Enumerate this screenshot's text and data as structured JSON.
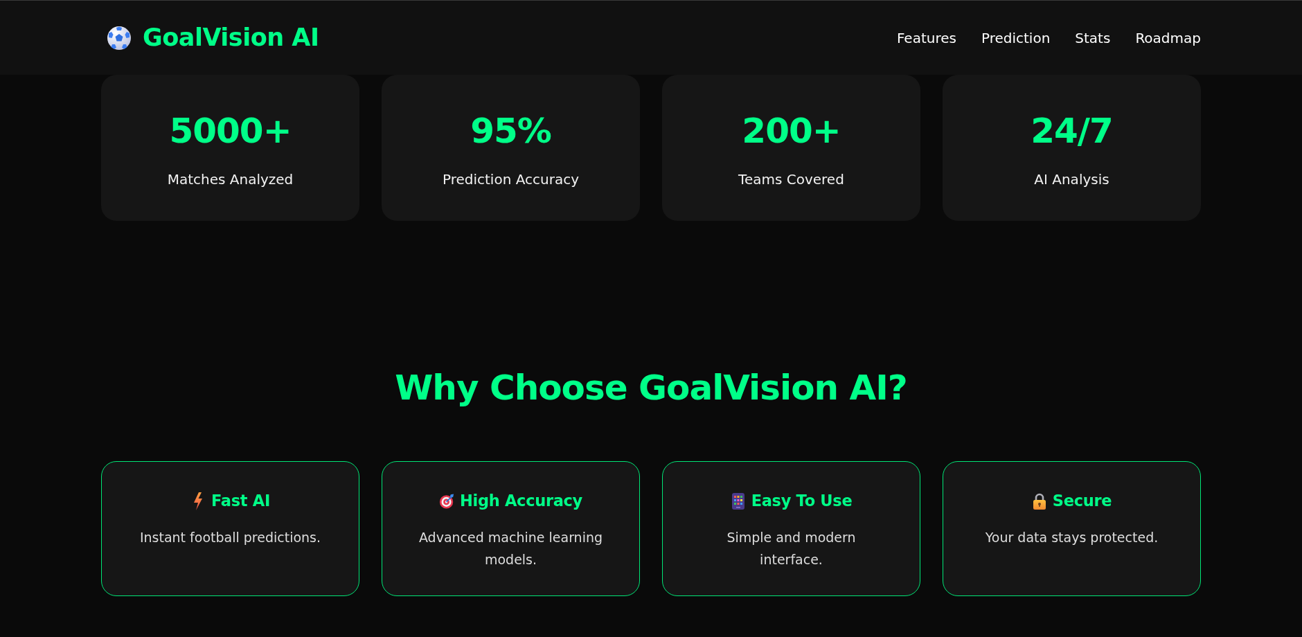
{
  "header": {
    "brand": "GoalVision AI",
    "nav": [
      "Features",
      "Prediction",
      "Stats",
      "Roadmap"
    ]
  },
  "stats": [
    {
      "value": "5000+",
      "label": "Matches Analyzed"
    },
    {
      "value": "95%",
      "label": "Prediction Accuracy"
    },
    {
      "value": "200+",
      "label": "Teams Covered"
    },
    {
      "value": "24/7",
      "label": "AI Analysis"
    }
  ],
  "features": {
    "title": "Why Choose GoalVision AI?",
    "items": [
      {
        "title": "Fast AI",
        "text": "Instant football predictions."
      },
      {
        "title": "High Accuracy",
        "text": "Advanced machine learning models."
      },
      {
        "title": "Easy To Use",
        "text": "Simple and modern interface."
      },
      {
        "title": "Secure",
        "text": "Your data stays protected."
      }
    ]
  }
}
